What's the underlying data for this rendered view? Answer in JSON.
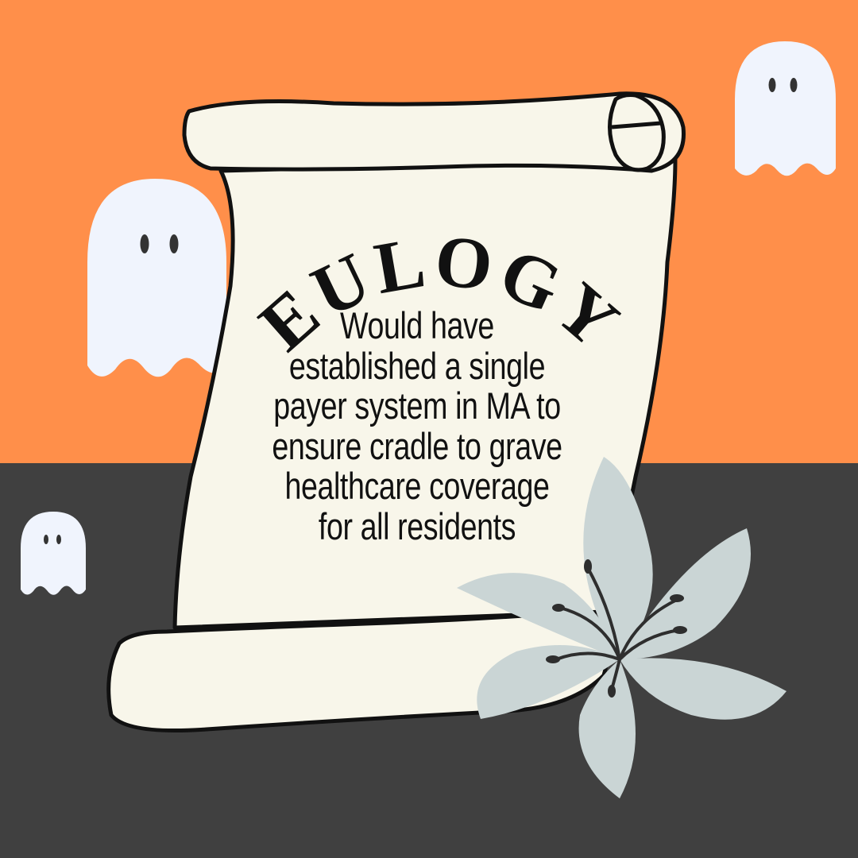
{
  "title": "EULOGY",
  "body_lines": [
    "Would have",
    "established a single",
    "payer system in MA to",
    "ensure cradle to grave",
    "healthcare coverage",
    "for all residents"
  ],
  "colors": {
    "orange": "#FF8F4A",
    "dark": "#404040",
    "parchment": "#F8F6EA",
    "ghost": "#F0F4FD",
    "lily": "#CAD5D5"
  }
}
